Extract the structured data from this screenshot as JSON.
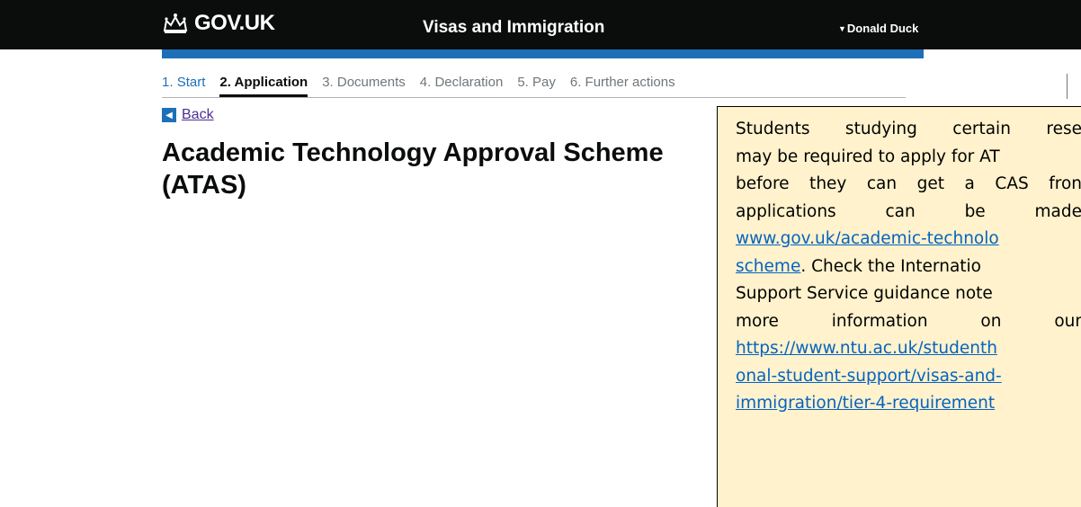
{
  "header": {
    "logo_text": "GOV.UK",
    "logo_icon": "crown-icon",
    "service_name": "Visas and Immigration",
    "user_name": "Donald Duck",
    "user_caret_icon": "caret-down-icon"
  },
  "steps": [
    {
      "number": "1.",
      "label": "Start",
      "state": "done"
    },
    {
      "number": "2.",
      "label": "Application",
      "state": "current"
    },
    {
      "number": "3.",
      "label": "Documents",
      "state": "upcoming"
    },
    {
      "number": "4.",
      "label": "Declaration",
      "state": "upcoming"
    },
    {
      "number": "5.",
      "label": "Pay",
      "state": "upcoming"
    },
    {
      "number": "6.",
      "label": "Further actions",
      "state": "upcoming"
    }
  ],
  "back": {
    "label": "Back",
    "icon": "left-arrow-icon"
  },
  "page": {
    "heading_line1": "Academic Technology Approval Scheme",
    "heading_line2": "(ATAS)"
  },
  "note": {
    "line1": "Students studying certain rese",
    "line2": "may be required to apply for AT",
    "line3": "before they can get a CAS fron",
    "line4": "applications can be made",
    "link1_line1": "www.gov.uk/academic-technolo",
    "link1_line2": "scheme",
    "line6_rest": ". Check the Internatio",
    "line7": "Support Service guidance note",
    "line8": "more information on our",
    "link2_line1": "https://www.ntu.ac.uk/studenth",
    "link2_line2": "onal-student-support/visas-and-",
    "link2_line3": "immigration/tier-4-requirement",
    "background": "#fff2cc"
  },
  "colors": {
    "header_bg": "#0b0c0c",
    "brand_blue": "#1d70b8",
    "visited_link": "#4c2c92",
    "note_link": "#0563c1"
  }
}
